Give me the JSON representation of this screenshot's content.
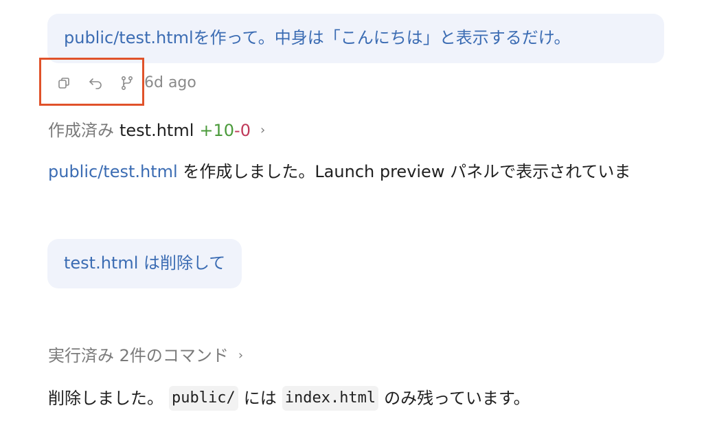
{
  "messages": {
    "first_user": "public/test.htmlを作って。中身は「こんにちは」と表示するだけ。",
    "second_user": "test.html は削除して"
  },
  "actions": {
    "timestamp": "6d ago"
  },
  "created": {
    "label": "作成済み",
    "filename": "test.html",
    "added": "+10",
    "removed": "-0",
    "chevron": "›"
  },
  "result": {
    "link": "public/test.html",
    "text": " を作成しました。Launch preview パネルで表示されていま"
  },
  "commands": {
    "label": "実行済み 2件のコマンド",
    "chevron": "›"
  },
  "deleted": {
    "prefix": "削除しました。",
    "code1": "public/",
    "middle": "には",
    "code2": "index.html",
    "suffix": "のみ残っています。"
  },
  "colors": {
    "bubble_bg": "#f0f3fb",
    "link": "#3b6cb3",
    "added": "#4a9a3a",
    "removed": "#c03a5a",
    "highlight": "#e0522a"
  }
}
